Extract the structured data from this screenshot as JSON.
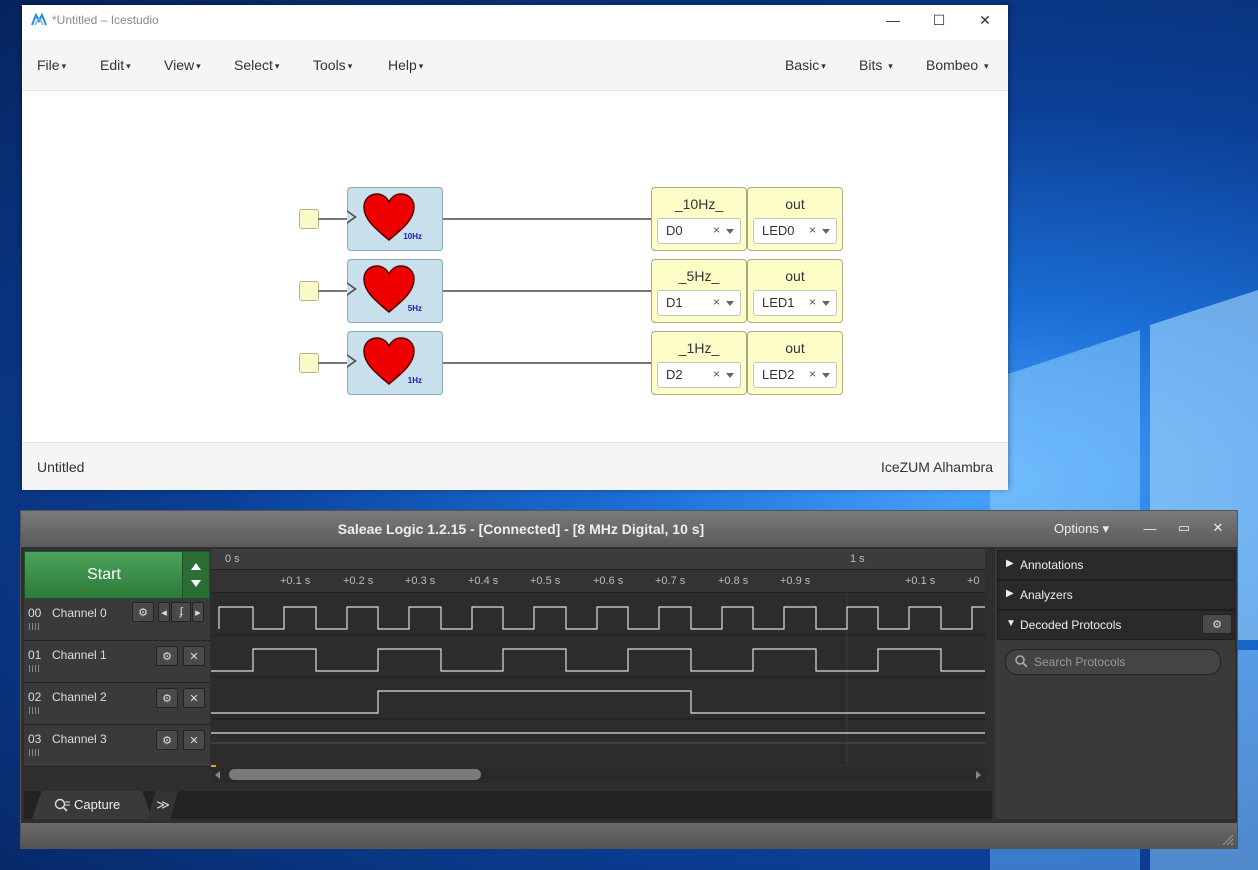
{
  "icestudio": {
    "title": "*Untitled – Icestudio",
    "controls": {
      "minimize": "—",
      "maximize": "☐",
      "close": "✕"
    },
    "menu": [
      "File",
      "Edit",
      "View",
      "Select",
      "Tools",
      "Help"
    ],
    "menu_right": [
      "Basic",
      "Bits",
      "Bombeo"
    ],
    "caret": "▾",
    "blocks": [
      {
        "freq": "10Hz",
        "pin_label": "_10Hz_",
        "pin_value": "D0",
        "out_label": "out",
        "out_value": "LED0"
      },
      {
        "freq": "5Hz",
        "pin_label": "_5Hz_",
        "pin_value": "D1",
        "out_label": "out",
        "out_value": "LED1"
      },
      {
        "freq": "1Hz",
        "pin_label": "_1Hz_",
        "pin_value": "D2",
        "out_label": "out",
        "out_value": "LED2"
      }
    ],
    "clear_glyph": "×",
    "footer_left": "Untitled",
    "footer_right": "IceZUM Alhambra"
  },
  "saleae": {
    "title": "Saleae Logic 1.2.15 - [Connected] - [8 MHz Digital, 10 s]",
    "options": "Options",
    "options_caret": "▾",
    "controls": {
      "minimize": "—",
      "maximize": "▭",
      "close": "✕"
    },
    "start": "Start",
    "channels": [
      {
        "num": "00",
        "name": "Channel 0"
      },
      {
        "num": "01",
        "name": "Channel 1"
      },
      {
        "num": "02",
        "name": "Channel 2"
      },
      {
        "num": "03",
        "name": "Channel 3"
      }
    ],
    "channel_buttons": {
      "settings": "⚙",
      "remove": "✕",
      "prev": "◂",
      "trigger": "ʄ",
      "next": "▸"
    },
    "timeline": {
      "major": [
        "0 s",
        "1 s"
      ],
      "minor": [
        "+0.1 s",
        "+0.2 s",
        "+0.3 s",
        "+0.4 s",
        "+0.5 s",
        "+0.6 s",
        "+0.7 s",
        "+0.8 s",
        "+0.9 s",
        "+0.1 s",
        "+0"
      ]
    },
    "panels": [
      "Annotations",
      "Analyzers",
      "Decoded Protocols"
    ],
    "search_placeholder": "Search Protocols",
    "capture_tab": "Capture",
    "more_tabs": "≫",
    "colors": {
      "ch0": "#555555",
      "ch1": "#8b4513",
      "ch2": "#d0312d",
      "ch3": "#f0a020",
      "start_green": "#3a8f47"
    }
  }
}
